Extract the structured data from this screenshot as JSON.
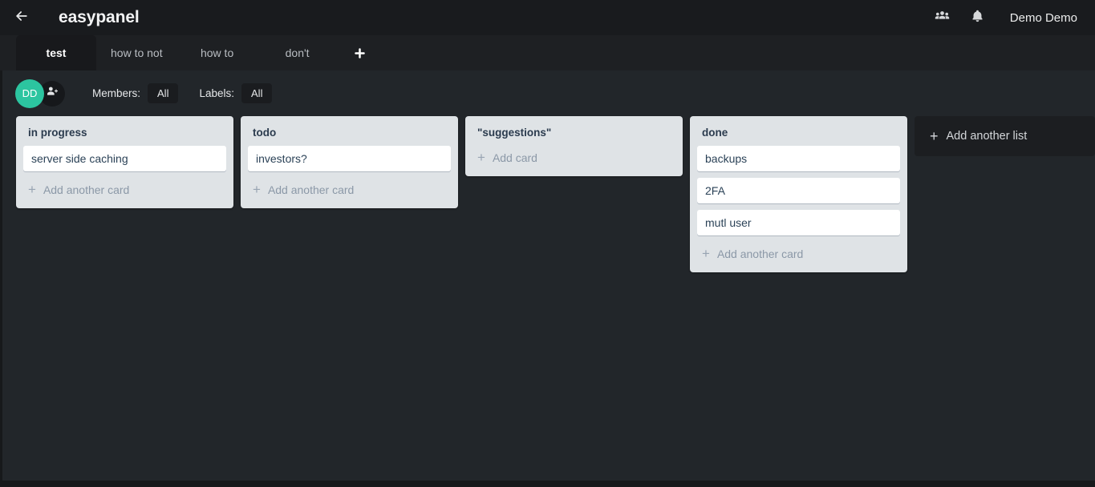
{
  "header": {
    "back_icon": "arrow-left-icon",
    "title": "easypanel",
    "members_icon": "people-icon",
    "notifications_icon": "bell-icon",
    "user_name": "Demo Demo"
  },
  "tabs": {
    "items": [
      {
        "label": "test",
        "active": true
      },
      {
        "label": "how to not",
        "active": false
      },
      {
        "label": "how to",
        "active": false
      },
      {
        "label": "don't",
        "active": false
      }
    ],
    "add_label": "+",
    "add_icon": "plus-icon"
  },
  "filter_bar": {
    "avatar_initials": "DD",
    "avatar_color": "#2cc5a0",
    "add_member_icon": "person-add-icon",
    "members_label": "Members:",
    "members_value": "All",
    "labels_label": "Labels:",
    "labels_value": "All"
  },
  "board": {
    "lists": [
      {
        "title": "in progress",
        "cards": [
          "server side caching"
        ],
        "add_card_label": "Add another card"
      },
      {
        "title": "todo",
        "cards": [
          "investors?"
        ],
        "add_card_label": "Add another card"
      },
      {
        "title": "\"suggestions\"",
        "cards": [],
        "add_card_label": "Add card"
      },
      {
        "title": "done",
        "cards": [
          "backups",
          "2FA",
          "mutl user"
        ],
        "add_card_label": "Add another card"
      }
    ],
    "add_list_label": "Add another list",
    "add_list_icon": "plus-icon"
  }
}
